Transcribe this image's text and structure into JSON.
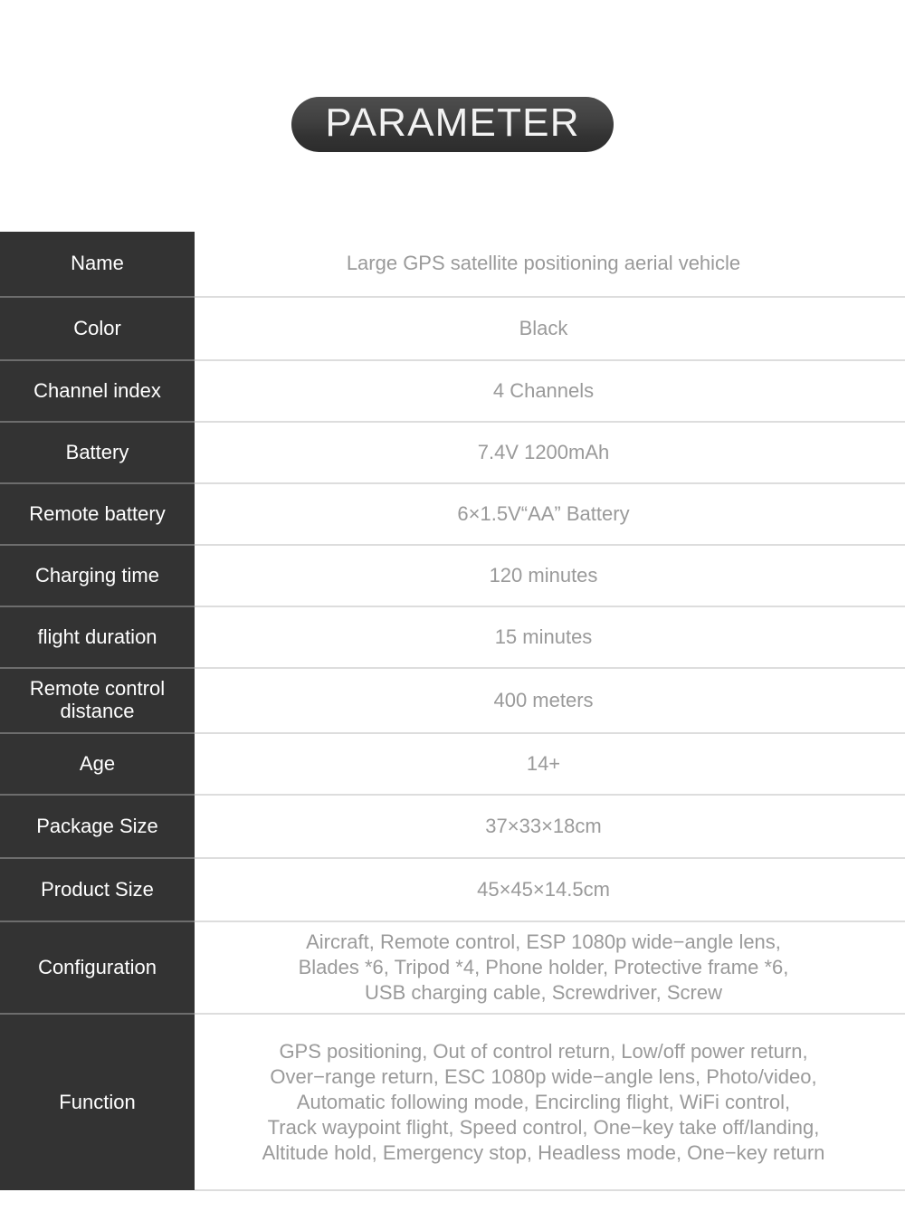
{
  "header": {
    "title": "PARAMETER"
  },
  "colors": {
    "label_background": "#333333",
    "label_text": "#ffffff",
    "value_text": "#9a9a9a",
    "value_background": "#ffffff",
    "row_divider_light": "#dddddd",
    "row_divider_dark": "#6d6d6d",
    "pill_top": "#4e4e4e",
    "pill_bottom": "#2c2c2c",
    "page_background": "#ffffff"
  },
  "spec_table": {
    "rows": [
      {
        "label": "Name",
        "value": "Large GPS satellite positioning aerial vehicle"
      },
      {
        "label": "Color",
        "value": "Black"
      },
      {
        "label": "Channel index",
        "value": "4 Channels"
      },
      {
        "label": "Battery",
        "value": "7.4V 1200mAh"
      },
      {
        "label": "Remote battery",
        "value": "6×1.5V“AA” Battery"
      },
      {
        "label": "Charging time",
        "value": "120 minutes"
      },
      {
        "label": "flight duration",
        "value": "15 minutes"
      },
      {
        "label": "Remote control distance",
        "value": "400 meters"
      },
      {
        "label": "Age",
        "value": "14+"
      },
      {
        "label": "Package Size",
        "value": "37×33×18cm"
      },
      {
        "label": "Product Size",
        "value": "45×45×14.5cm"
      },
      {
        "label": "Configuration",
        "value": "Aircraft, Remote control, ESP 1080p wide−angle lens, Blades *6, Tripod *4, Phone holder, Protective frame *6, USB charging cable, Screwdriver, Screw"
      },
      {
        "label": "Function",
        "value": "GPS positioning, Out of control return, Low/off power return, Over−range return, ESC 1080p wide−angle lens, Photo/video, Automatic following mode, Encircling flight, WiFi control, Track waypoint flight, Speed control, One−key take off/landing, Altitude hold, Emergency stop, Headless mode, One−key return"
      }
    ],
    "label_lines": {
      "remote_control_distance_line1": "Remote control",
      "remote_control_distance_line2": "distance"
    },
    "value_lines": {
      "configuration": [
        "Aircraft, Remote control, ESP 1080p wide−angle lens,",
        "Blades *6, Tripod *4, Phone holder, Protective frame *6,",
        "USB charging cable, Screwdriver, Screw"
      ],
      "function": [
        "GPS positioning, Out of control return, Low/off power return,",
        "Over−range return, ESC 1080p wide−angle lens, Photo/video,",
        "Automatic following mode, Encircling flight, WiFi control,",
        "Track waypoint flight, Speed control, One−key take off/landing,",
        "Altitude hold, Emergency stop, Headless mode, One−key return"
      ]
    }
  }
}
